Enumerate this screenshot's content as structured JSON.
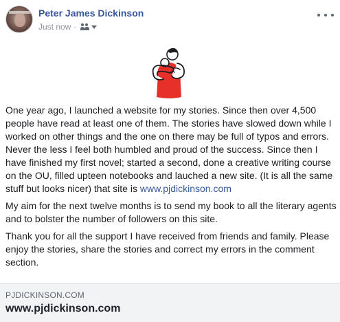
{
  "post": {
    "author": "Peter James Dickinson",
    "timestamp": "Just now",
    "separator": "·",
    "audience_icon": "friends-icon",
    "more_icon": "more-options-icon",
    "paragraphs": [
      "One year ago, I launched a website for my stories. Since then over 4,500 people have read at least one of them. The stories have slowed down while I worked on other things and the one on there may be full of typos and errors. Never the less I feel both humbled and proud of the success. Since then I have finished my first novel; started a second, done a creative writing course on the OU, filled upteen notebooks and lauched a new site. (It is all the same stuff but looks nicer) that site is ",
      "My aim for the next twelve months is to send my book to all the literary agents and to bolster the number of followers on this site.",
      "Thank you for all the support I have received from friends and family. Please enjoy the stories, share the stories and correct my errors in the comment section."
    ],
    "inline_link": "www.pjdickinson.com",
    "link_card": {
      "domain": "PJDICKINSON.COM",
      "title": "www.pjdickinson.com"
    }
  },
  "colors": {
    "author_blue": "#385898",
    "hug_red": "#e8302b"
  }
}
